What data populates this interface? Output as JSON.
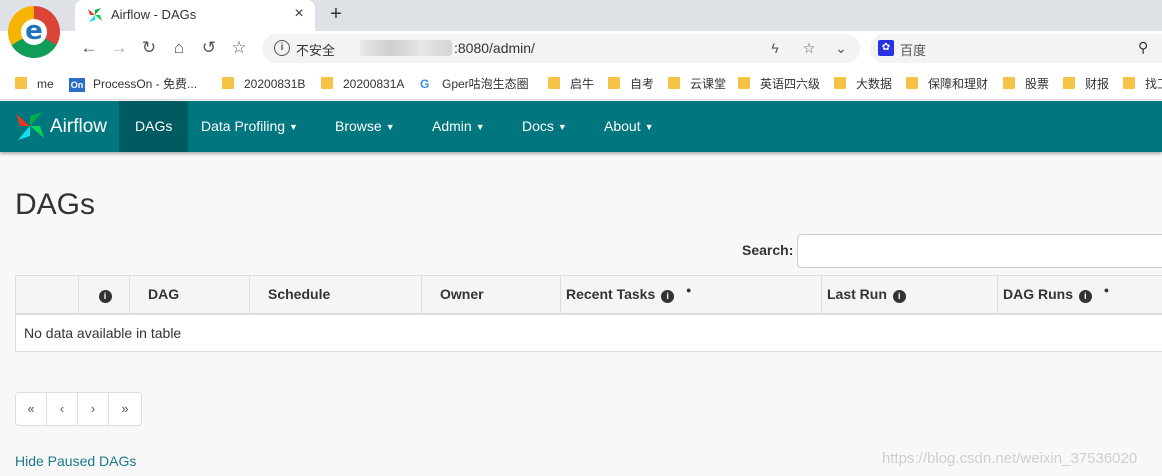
{
  "browser": {
    "tab_title": "Airflow - DAGs",
    "tab_close": "×",
    "new_tab": "+",
    "back": "←",
    "forward": "→",
    "reload": "↻",
    "home": "⌂",
    "undo": "↺",
    "bookmark_star": "☆",
    "info": "i",
    "security_label": "不安全",
    "url": ":8080/admin/",
    "lightning": "ϟ",
    "star": "☆",
    "dropdown": "⌄",
    "search_engine_label": "百度",
    "search_icon": "⚲",
    "bookmarks": [
      {
        "label": "me",
        "icon": "folder"
      },
      {
        "label": "ProcessOn - 免费...",
        "icon": "on-badge"
      },
      {
        "label": "20200831B",
        "icon": "folder"
      },
      {
        "label": "20200831A",
        "icon": "folder"
      },
      {
        "label": "Gper咕泡生态圈",
        "icon": "gper"
      },
      {
        "label": "启牛",
        "icon": "folder"
      },
      {
        "label": "自考",
        "icon": "folder"
      },
      {
        "label": "云课堂",
        "icon": "folder"
      },
      {
        "label": "英语四六级",
        "icon": "folder"
      },
      {
        "label": "大数据",
        "icon": "folder"
      },
      {
        "label": "保障和理财",
        "icon": "folder"
      },
      {
        "label": "股票",
        "icon": "folder"
      },
      {
        "label": "财报",
        "icon": "folder"
      },
      {
        "label": "找工",
        "icon": "folder"
      }
    ]
  },
  "navbar": {
    "brand": "Airflow",
    "items": [
      {
        "label": "DAGs",
        "active": true
      },
      {
        "label": "Data Profiling",
        "dropdown": true
      },
      {
        "label": "Browse",
        "dropdown": true
      },
      {
        "label": "Admin",
        "dropdown": true
      },
      {
        "label": "Docs",
        "dropdown": true
      },
      {
        "label": "About",
        "dropdown": true
      }
    ],
    "caret": "▼"
  },
  "main": {
    "title": "DAGs",
    "search_label": "Search:",
    "search_value": "",
    "table": {
      "columns": [
        "",
        "",
        "DAG",
        "Schedule",
        "Owner",
        "Recent Tasks",
        "Last Run",
        "DAG Runs"
      ],
      "info_icon": "i",
      "sort_dot": "●",
      "empty_message": "No data available in table"
    },
    "pager": [
      "«",
      "‹",
      "›",
      "»"
    ],
    "hide_paused": "Hide Paused DAGs"
  },
  "watermark": "https://blog.csdn.net/weixin_37536020",
  "colors": {
    "navbar": "#00767f",
    "navbar_active": "#005a61",
    "link": "#1a7a8a"
  }
}
